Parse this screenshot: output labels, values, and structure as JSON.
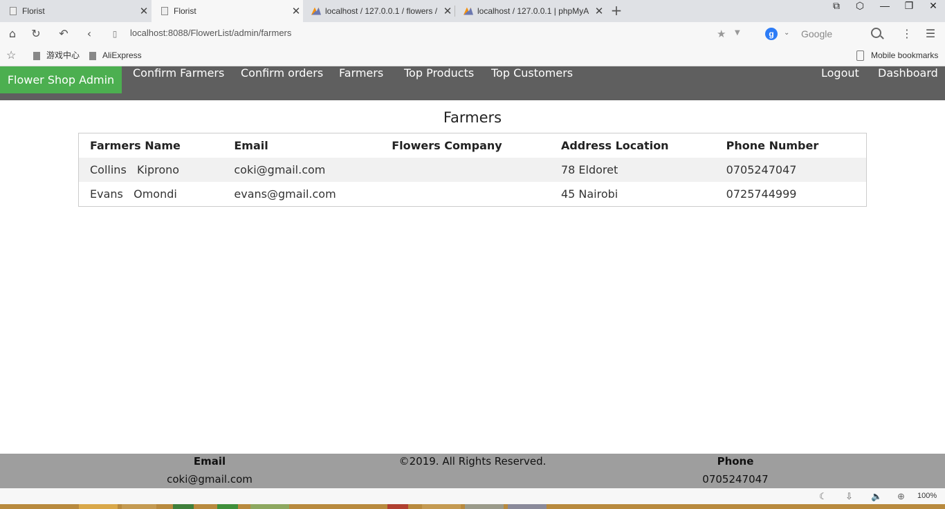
{
  "browser": {
    "tabs": [
      {
        "title": "Florist",
        "active": false
      },
      {
        "title": "Florist",
        "active": true
      },
      {
        "title": "localhost / 127.0.0.1 / flowers /",
        "active": false
      },
      {
        "title": "localhost / 127.0.0.1 | phpMyA",
        "active": false
      }
    ],
    "url": "localhost:8088/FlowerList/admin/farmers",
    "search_engine_badge": "g",
    "search_placeholder": "Google",
    "bookmarks": [
      "游戏中心",
      "AliExpress"
    ],
    "mobile_bookmarks": "Mobile bookmarks",
    "zoom": "100%"
  },
  "nav": {
    "brand": "Flower Shop Admin",
    "items": [
      "Confirm Farmers",
      "Confirm orders",
      "Farmers",
      "Top Products",
      "Top Customers"
    ],
    "right_items": [
      "Logout",
      "Dashboard"
    ],
    "brand_color": "#4caf50",
    "bar_color": "#5f5f5f"
  },
  "page": {
    "title": "Farmers",
    "table": {
      "headers": [
        "Farmers Name",
        "Email",
        "Flowers Company",
        "Address Location",
        "Phone Number"
      ],
      "rows": [
        [
          "Collins   Kiprono",
          "coki@gmail.com",
          "",
          "78 Eldoret",
          "0705247047"
        ],
        [
          "Evans   Omondi",
          "evans@gmail.com",
          "",
          "45 Nairobi",
          "0725744999"
        ]
      ]
    }
  },
  "footer": {
    "email_label": "Email",
    "email_value": "coki@gmail.com",
    "copyright": "©2019. All Rights Reserved.",
    "phone_label": "Phone",
    "phone_value": "0705247047"
  }
}
